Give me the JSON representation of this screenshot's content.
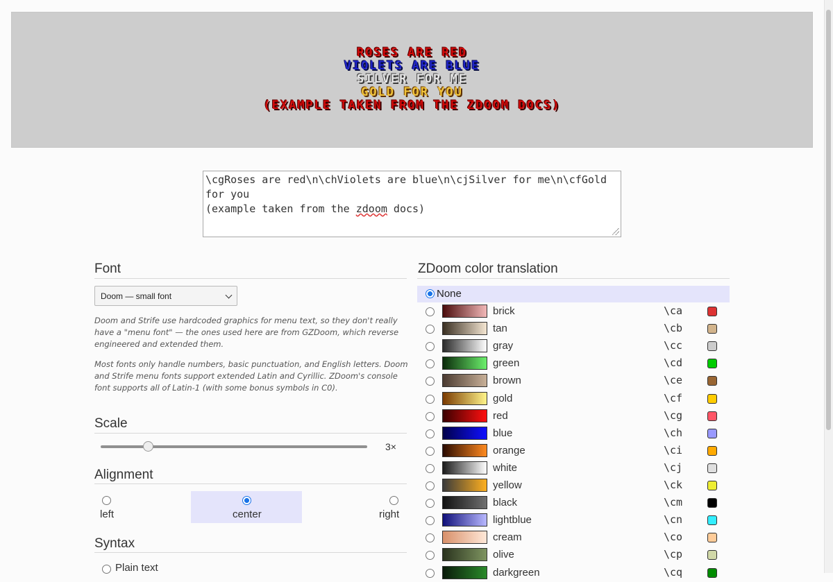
{
  "preview": {
    "lines": [
      {
        "text": "ROSES ARE RED",
        "color": "#d10a0a"
      },
      {
        "text": "VIOLETS ARE BLUE",
        "color": "#1f24c8"
      },
      {
        "text": "SILVER FOR ME",
        "color": "#e6e6e6"
      },
      {
        "text": "GOLD FOR YOU",
        "color": "#f0c23a"
      },
      {
        "text": "(EXAMPLE TAKEN FROM THE ZDOOM DOCS)",
        "color": "#d10a0a"
      }
    ]
  },
  "editor": {
    "text_before": "\\cgRoses are red\\n\\chViolets are blue\\n\\cjSilver for me\\n\\cfGold for you\n(example taken from the ",
    "text_underlined": "zdoom",
    "text_after": " docs)"
  },
  "font_section": {
    "heading": "Font",
    "selected": "Doom — small font",
    "note1": "Doom and Strife use hardcoded graphics for menu text, so they don't really have a \"menu font\" — the ones used here are from GZDoom, which reverse engineered and extended them.",
    "note2": "Most fonts only handle numbers, basic punctuation, and English letters. Doom and Strife menu fonts support extended Latin and Cyrillic. ZDoom's console font supports all of Latin-1 (with some bonus symbols in C0)."
  },
  "scale": {
    "heading": "Scale",
    "value_label": "3×",
    "value": 3
  },
  "alignment": {
    "heading": "Alignment",
    "options": [
      "left",
      "center",
      "right"
    ],
    "selected": "center"
  },
  "syntax": {
    "heading": "Syntax",
    "option1": "Plain text"
  },
  "translation": {
    "heading": "ZDoom color translation",
    "none_label": "None",
    "items": [
      {
        "name": "brick",
        "code": "\\ca",
        "grad": [
          "#4a0b0b",
          "#f2b8b8"
        ],
        "swatch": "#dd3333"
      },
      {
        "name": "tan",
        "code": "\\cb",
        "grad": [
          "#3a2f22",
          "#f4e6d2"
        ],
        "swatch": "#d2b48c"
      },
      {
        "name": "gray",
        "code": "\\cc",
        "grad": [
          "#2a2a2a",
          "#ffffff"
        ],
        "swatch": "#cccccc"
      },
      {
        "name": "green",
        "code": "\\cd",
        "grad": [
          "#0a2a0a",
          "#6cf06c"
        ],
        "swatch": "#00cc00"
      },
      {
        "name": "brown",
        "code": "\\ce",
        "grad": [
          "#4a3a30",
          "#c8b098"
        ],
        "swatch": "#996633"
      },
      {
        "name": "gold",
        "code": "\\cf",
        "grad": [
          "#7a3a00",
          "#fff48a"
        ],
        "swatch": "#ffcc00"
      },
      {
        "name": "red",
        "code": "\\cg",
        "grad": [
          "#3a0000",
          "#ff1010"
        ],
        "swatch": "#ff5566"
      },
      {
        "name": "blue",
        "code": "\\ch",
        "grad": [
          "#00004a",
          "#1010ff"
        ],
        "swatch": "#9999ff"
      },
      {
        "name": "orange",
        "code": "\\ci",
        "grad": [
          "#2a0a00",
          "#ff8a20"
        ],
        "swatch": "#ffaa00"
      },
      {
        "name": "white",
        "code": "\\cj",
        "grad": [
          "#1a1a1a",
          "#ffffff"
        ],
        "swatch": "#dfdfdf"
      },
      {
        "name": "yellow",
        "code": "\\ck",
        "grad": [
          "#3a3a3a",
          "#ffb020"
        ],
        "swatch": "#eeee33"
      },
      {
        "name": "black",
        "code": "\\cm",
        "grad": [
          "#111111",
          "#707070"
        ],
        "swatch": "#000000"
      },
      {
        "name": "lightblue",
        "code": "\\cn",
        "grad": [
          "#10107a",
          "#b8b8ff"
        ],
        "swatch": "#33eeff"
      },
      {
        "name": "cream",
        "code": "\\co",
        "grad": [
          "#d8906a",
          "#ffe8d8"
        ],
        "swatch": "#ffcc99"
      },
      {
        "name": "olive",
        "code": "\\cp",
        "grad": [
          "#2a331e",
          "#7e9460"
        ],
        "swatch": "#d1d8a8"
      },
      {
        "name": "darkgreen",
        "code": "\\cq",
        "grad": [
          "#0a1a0a",
          "#2a8a2a"
        ],
        "swatch": "#008c00"
      }
    ]
  }
}
